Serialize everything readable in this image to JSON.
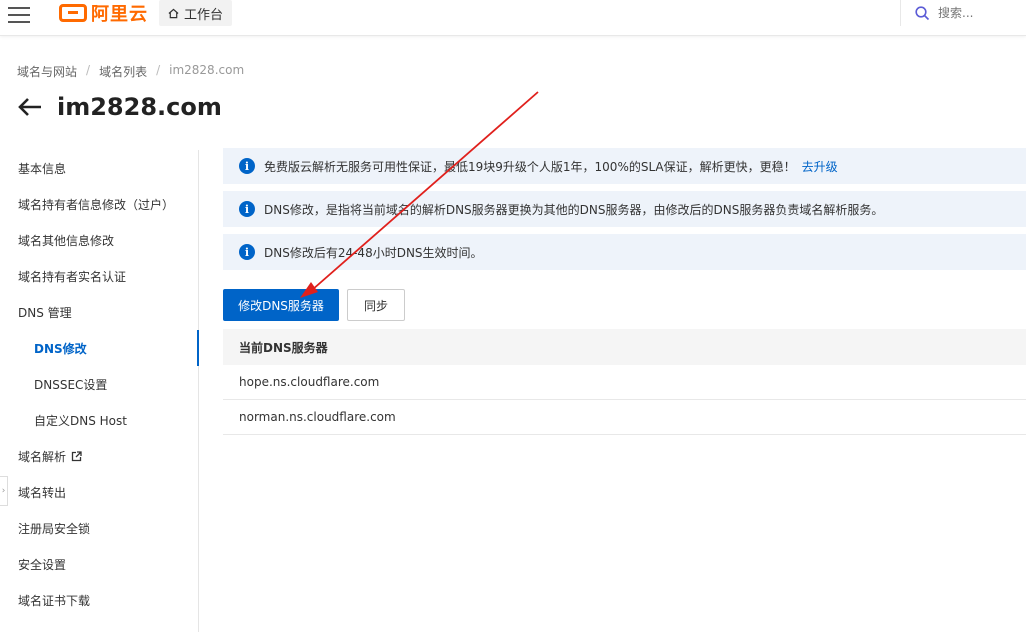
{
  "topbar": {
    "logo_text": "阿里云",
    "workbench_label": "工作台",
    "search_placeholder": "搜索..."
  },
  "breadcrumb": [
    "域名与网站",
    "域名列表",
    "im2828.com"
  ],
  "page_title": "im2828.com",
  "sidebar": {
    "items": [
      {
        "label": "基本信息"
      },
      {
        "label": "域名持有者信息修改（过户）"
      },
      {
        "label": "域名其他信息修改"
      },
      {
        "label": "域名持有者实名认证"
      },
      {
        "label": "DNS 管理"
      },
      {
        "label": "DNS修改"
      },
      {
        "label": "DNSSEC设置"
      },
      {
        "label": "自定义DNS Host"
      },
      {
        "label": "域名解析"
      },
      {
        "label": "域名转出"
      },
      {
        "label": "注册局安全锁"
      },
      {
        "label": "安全设置"
      },
      {
        "label": "域名证书下载"
      }
    ]
  },
  "notices": [
    {
      "text": "免费版云解析无服务可用性保证，最低19块9升级个人版1年，100%的SLA保证，解析更快，更稳！",
      "link": "去升级"
    },
    {
      "text": "DNS修改，是指将当前域名的解析DNS服务器更换为其他的DNS服务器，由修改后的DNS服务器负责域名解析服务。"
    },
    {
      "text": "DNS修改后有24-48小时DNS生效时间。"
    }
  ],
  "buttons": {
    "modify_dns": "修改DNS服务器",
    "sync": "同步"
  },
  "table": {
    "header": "当前DNS服务器",
    "rows": [
      "hope.ns.cloudflare.com",
      "norman.ns.cloudflare.com"
    ]
  },
  "colors": {
    "brand": "#ff6a00",
    "primary": "#0064c8",
    "notice_bg": "#eef3fa",
    "annotation_arrow": "#e0201c"
  }
}
